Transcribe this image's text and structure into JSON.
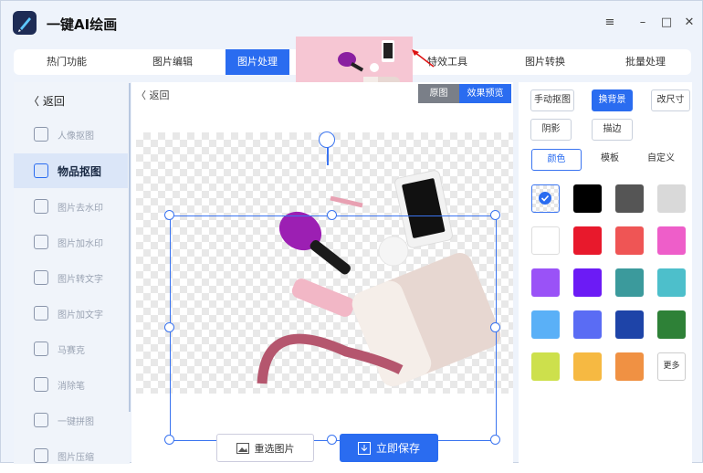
{
  "app": {
    "title": "一键AI绘画"
  },
  "window": {
    "menu": "≡",
    "minimize": "–",
    "maximize": "□",
    "close": "✕"
  },
  "tabs": [
    "热门功能",
    "图片编辑",
    "图片处理",
    "特效工具",
    "图片转换",
    "批量处理"
  ],
  "sidebar": {
    "back": "返回",
    "items": [
      "人像抠图",
      "物品抠图",
      "图片去水印",
      "图片加水印",
      "图片转文字",
      "图片加文字",
      "马赛克",
      "消除笔",
      "一键拼图",
      "图片压缩"
    ]
  },
  "main": {
    "back": "返回",
    "original": "原图",
    "preview": "效果预览",
    "reselect": "重选图片",
    "save": "立即保存"
  },
  "panel": {
    "manual": "手动抠图",
    "change_bg": "换背景",
    "resize": "改尺寸",
    "shadow": "阴影",
    "stroke": "描边",
    "sub_tabs": [
      "颜色",
      "模板",
      "自定义"
    ],
    "more": "更多"
  },
  "colors": [
    "transparent",
    "#000000",
    "#555555",
    "#d9d9d9",
    "#ffffff",
    "#e8192c",
    "#ef5555",
    "#ee5ec9",
    "#9a52f7",
    "#6c1bf5",
    "#3b9a9c",
    "#4dbfcb",
    "#5ab0f7",
    "#5a6cf4",
    "#1e44a8",
    "#2e8137",
    "#cde04c",
    "#f6b942",
    "#f09143"
  ],
  "accent": "#2a6cf0",
  "icons": [
    "menu-icon",
    "minimize-icon",
    "maximize-icon",
    "close-icon",
    "back-icon",
    "image-icon",
    "download-icon",
    "check-icon"
  ]
}
